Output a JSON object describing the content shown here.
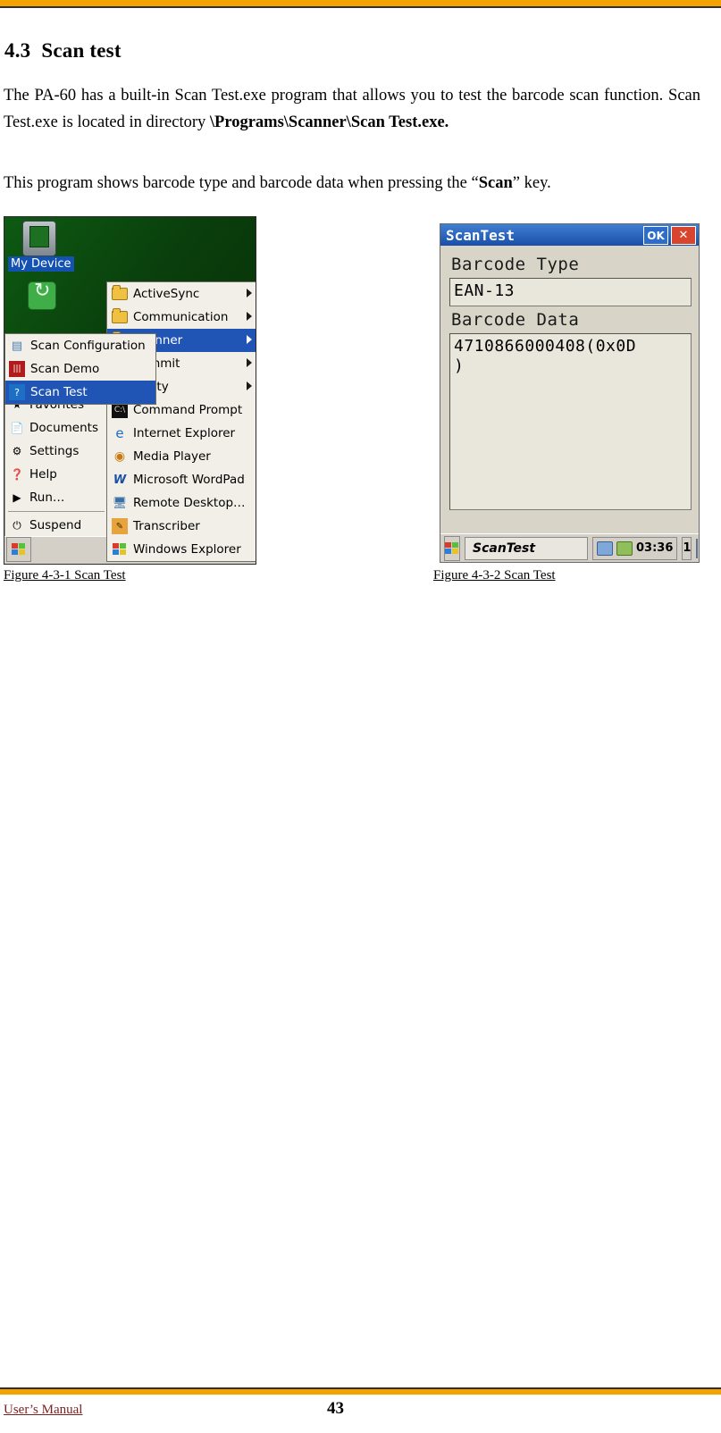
{
  "document": {
    "section_number": "4.3",
    "section_title": "Scan test",
    "paragraph_1_part1": "The PA-60 has a built-in Scan Test.exe program that allows you to test the barcode scan function.  Scan Test.exe is located in directory ",
    "paragraph_1_bold": "\\Programs\\Scanner\\Scan Test.exe.",
    "paragraph_2_part1": "This program shows barcode type and barcode data when pressing the “",
    "paragraph_2_bold": "Scan",
    "paragraph_2_part2": "” key.",
    "caption_1": "Figure 4-3-1 Scan Test ",
    "caption_2": "Figure 4-3-2 Scan Test",
    "footer_left": "User’s Manual",
    "page_number": "43"
  },
  "figure1": {
    "desktop": {
      "my_device_label": "My Device",
      "my_device_icon": "device-icon",
      "recycle_icon": "recycle-bin-icon",
      "favorites_icon": "favorites-icon"
    },
    "start_menu": {
      "items": [
        {
          "label": "Favorites",
          "icon": "favorites-icon"
        },
        {
          "label": "Documents",
          "icon": "documents-icon"
        },
        {
          "label": "Settings",
          "icon": "settings-icon"
        },
        {
          "label": "Help",
          "icon": "help-icon"
        },
        {
          "label": "Run…",
          "icon": "run-icon"
        },
        {
          "label": "Suspend",
          "icon": "suspend-icon"
        }
      ]
    },
    "programs_menu": {
      "items": [
        {
          "label": "ActiveSync",
          "icon": "folder-icon",
          "submenu": true,
          "selected": false
        },
        {
          "label": "Communication",
          "icon": "folder-icon",
          "submenu": true,
          "selected": false
        },
        {
          "label": "Scanner",
          "icon": "folder-icon",
          "submenu": true,
          "selected": true
        },
        {
          "label": "Summit",
          "icon": "folder-icon",
          "submenu": true,
          "selected": false
        },
        {
          "label": "Utility",
          "icon": "folder-icon",
          "submenu": true,
          "selected": false
        },
        {
          "label": "Command Prompt",
          "icon": "command-prompt-icon",
          "submenu": false,
          "selected": false
        },
        {
          "label": "Internet Explorer",
          "icon": "internet-explorer-icon",
          "submenu": false,
          "selected": false
        },
        {
          "label": "Media Player",
          "icon": "media-player-icon",
          "submenu": false,
          "selected": false
        },
        {
          "label": "Microsoft WordPad",
          "icon": "wordpad-icon",
          "submenu": false,
          "selected": false
        },
        {
          "label": "Remote Desktop…",
          "icon": "remote-desktop-icon",
          "submenu": false,
          "selected": false
        },
        {
          "label": "Transcriber",
          "icon": "transcriber-icon",
          "submenu": false,
          "selected": false
        },
        {
          "label": "Windows Explorer",
          "icon": "windows-explorer-icon",
          "submenu": false,
          "selected": false
        }
      ]
    },
    "scanner_submenu": {
      "items": [
        {
          "label": "Scan Configuration",
          "icon": "scan-configuration-icon",
          "selected": false
        },
        {
          "label": "Scan Demo",
          "icon": "scan-demo-icon",
          "selected": false
        },
        {
          "label": "Scan Test",
          "icon": "scan-test-icon",
          "selected": true
        }
      ]
    },
    "taskbar": {
      "start_icon": "windows-start-icon"
    },
    "colors": {
      "selection": "#2155b5",
      "menu_bg": "#f1efe7",
      "desktop": "#0a3d0a"
    }
  },
  "figure2": {
    "window": {
      "title": "ScanTest",
      "ok_button": "OK",
      "close_button": "✕"
    },
    "fields": [
      {
        "label": "Barcode Type",
        "value": "EAN-13"
      },
      {
        "label": "Barcode Data",
        "value": "4710866000408(0x0D\n)"
      }
    ],
    "taskbar": {
      "start_icon": "windows-start-icon",
      "task_button": "ScanTest",
      "tray_icons": [
        "network-icon",
        "radio-icon"
      ],
      "clock": "03:36",
      "input_panel": "1",
      "keyboard_icon": "keyboard-icon"
    },
    "colors": {
      "titlebar": "#1a4fa8",
      "close": "#d8452f",
      "body": "#d8d4c8"
    }
  }
}
